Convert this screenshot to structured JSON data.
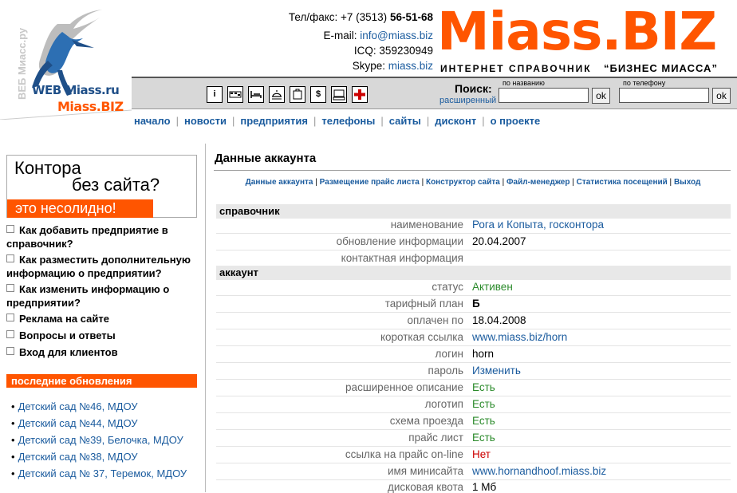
{
  "logo": {
    "line1": "WEB Miass.ru",
    "line2": "Miass.BIZ",
    "vertical": "ВЕБ Миасс.ру"
  },
  "contacts": {
    "phone_label": "Тел/факс: +7 (3513)",
    "phone_num": "56-51-68",
    "email_label": "E-mail:",
    "email": "info@miass.biz",
    "icq": "ICQ: 359230949",
    "skype_label": "Skype:",
    "skype": "miass.biz"
  },
  "brand": {
    "title": "Miass.BIZ",
    "subtitle": "ИНТЕРНЕТ СПРАВОЧНИК",
    "subtitle_quote": "“БИЗНЕС МИАССА”"
  },
  "toolbar": {
    "icons": [
      "info-icon",
      "taxi-icon",
      "hotel-icon",
      "food-icon",
      "shopping-icon",
      "money-icon",
      "computer-icon",
      "medical-icon"
    ]
  },
  "search": {
    "label": "Поиск:",
    "advanced": "расширенный",
    "by_name_caption": "по названию",
    "by_phone_caption": "по телефону",
    "ok1": "ok",
    "ok2": "ok"
  },
  "nav": [
    "начало",
    "новости",
    "предприятия",
    "телефоны",
    "сайты",
    "дисконт",
    "о проекте"
  ],
  "promo": {
    "line1": "Контора",
    "line2": "без сайта?",
    "bar": "это несолидно!"
  },
  "faq": [
    "Как добавить предприятие в справочник?",
    "Как разместить дополнительную информацию о предприятии?",
    "Как изменить информацию о предприятии?",
    "Реклама на сайте",
    "Вопросы и ответы",
    "Вход для клиентов"
  ],
  "updates": {
    "heading": "последние обновления",
    "items": [
      "Детский сад №46, МДОУ",
      "Детский сад №44, МДОУ",
      "Детский сад №39, Белочка, МДОУ",
      "Детский сад №38, МДОУ",
      "Детский сад № 37, Теремок, МДОУ"
    ]
  },
  "account": {
    "title": "Данные аккаунта",
    "sublinks": [
      "Данные аккаунта",
      "Размещение прайс листа",
      "Конструктор сайта",
      "Файл-менеджер",
      "Статистика посещений",
      "Выход"
    ],
    "section1": "справочник",
    "section2": "аккаунт",
    "rows1": [
      {
        "label": "наименование",
        "value": "Рога и Копыта, госконтора"
      },
      {
        "label": "обновление информации",
        "value": "20.04.2007"
      },
      {
        "label": "контактная информация",
        "value": ""
      }
    ],
    "rows2": [
      {
        "label": "статус",
        "value": "Активен"
      },
      {
        "label": "тарифный план",
        "value": "Б"
      },
      {
        "label": "оплачен по",
        "value": "18.04.2008"
      },
      {
        "label": "короткая ссылка",
        "value": "www.miass.biz/horn"
      },
      {
        "label": "логин",
        "value": "horn"
      },
      {
        "label": "пароль",
        "value": "Изменить"
      },
      {
        "label": "расширенное описание",
        "value": "Есть"
      },
      {
        "label": "логотип",
        "value": "Есть"
      },
      {
        "label": "схема проезда",
        "value": "Есть"
      },
      {
        "label": "прайс лист",
        "value": "Есть"
      },
      {
        "label": "ссылка на прайс on-line",
        "value": "Нет"
      },
      {
        "label": "имя минисайта",
        "value": "www.hornandhoof.miass.biz"
      },
      {
        "label": "дисковая квота",
        "value": "1 Мб"
      }
    ]
  },
  "colors": {
    "brand": "#ff5500",
    "link": "#1a5b9e",
    "ok": "#2a8a2a",
    "no": "#cc0000"
  }
}
